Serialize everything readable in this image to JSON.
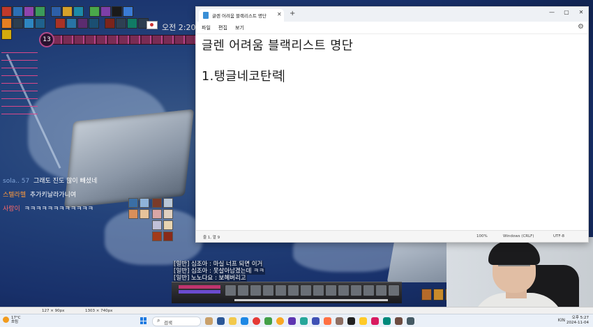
{
  "game": {
    "clock": "오전 2:20",
    "level": "13",
    "chat": [
      {
        "name": "sola.. 57",
        "text": "그래도 진도 많이 빼셨네"
      },
      {
        "name": "스텔라헬",
        "text": "추가키날라가니여"
      },
      {
        "name": "사랑이",
        "text": "ㅋㅋㅋㅋㅋㅋㅋㅋㅋㅋㅋㅋ"
      }
    ],
    "system_chat": [
      "[일반] 심조아 : 마실 너프 되면 이거",
      "[일반] 심조아 : 못살아남겠는데 ㅋㅋ",
      "[일반] 노노다요 : 보혜버리고"
    ]
  },
  "notepad": {
    "tab_title": "글렌 어려움 블랙리스트 명단",
    "new_tab": "+",
    "tab_close": "✕",
    "window_controls": {
      "minimize": "—",
      "maximize": "▢",
      "close": "✕"
    },
    "menu": {
      "file": "파일",
      "edit": "편집",
      "view": "보기"
    },
    "content": {
      "line1": "글렌 어려움 블랙리스트 명단",
      "line2": "1.탱글네코탄력"
    },
    "status": {
      "position": "줄 1, 열 9",
      "zoom": "100%",
      "line_ending": "Windows (CRLF)",
      "encoding": "UTF-8"
    }
  },
  "recording_strip": {
    "cursor": "127 × 90px",
    "size": "1303 × 740px"
  },
  "taskbar": {
    "weather_temp": "17°C",
    "weather_desc": "흐림",
    "search_label": "검색",
    "lang": "KIN",
    "time": "오후 5:27",
    "date": "2024-11-04"
  }
}
